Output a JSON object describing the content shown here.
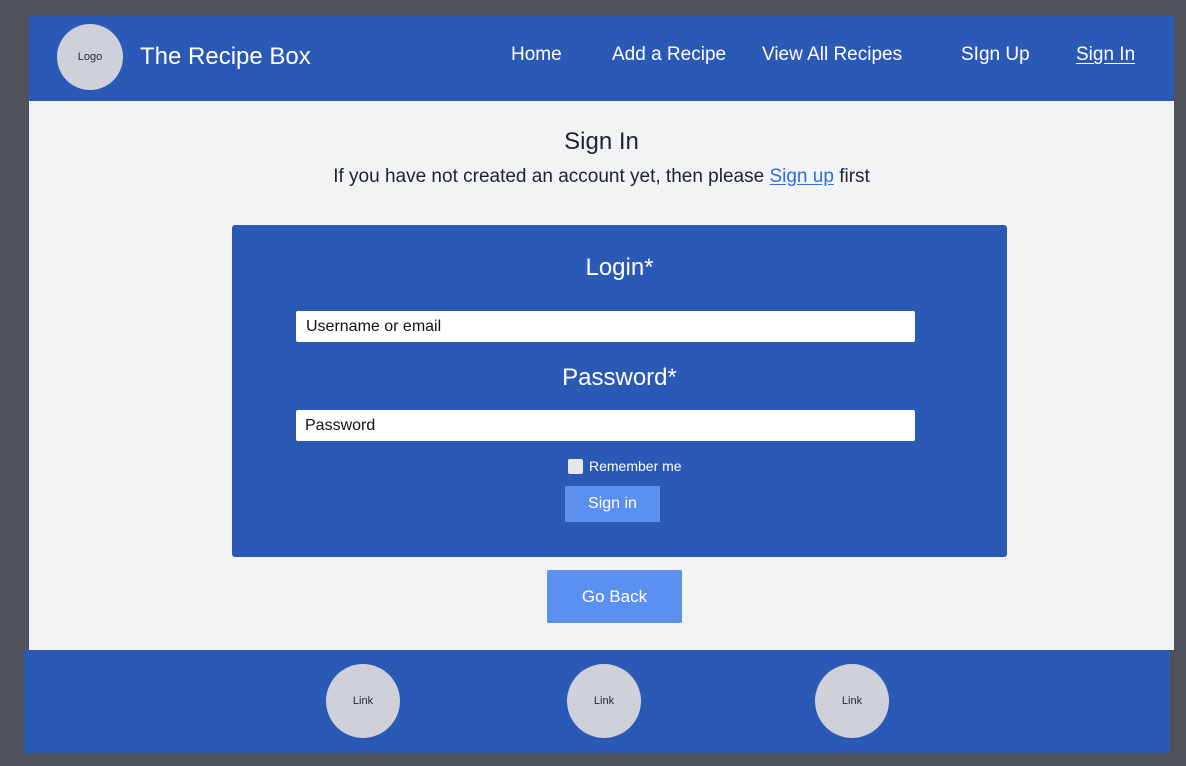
{
  "header": {
    "logo_text": "Logo",
    "brand": "The Recipe Box",
    "nav": [
      {
        "label": "Home"
      },
      {
        "label": "Add a Recipe"
      },
      {
        "label": "View All Recipes"
      },
      {
        "label": "SIgn Up"
      },
      {
        "label": "Sign In",
        "active": true
      }
    ]
  },
  "main": {
    "title": "Sign In",
    "subtitle_before": "If you have not created an account yet, then please",
    "subtitle_link": "Sign up",
    "subtitle_after": "first"
  },
  "form": {
    "login_label": "Login*",
    "login_placeholder": "Username or email",
    "password_label": "Password*",
    "password_placeholder": "Password",
    "remember_label": "Remember me",
    "remember_checked": false,
    "submit_label": "Sign in"
  },
  "go_back_label": "Go Back",
  "footer": {
    "links": [
      {
        "label": "Link"
      },
      {
        "label": "Link"
      },
      {
        "label": "Link"
      }
    ]
  },
  "colors": {
    "outer_background": "#4f525a",
    "page_background": "#f2f3f5",
    "brand_blue": "#2a5ab6",
    "button_blue": "#5b8ff0",
    "link_blue": "#2f6fd6",
    "placeholder_circle": "#ced1d9"
  }
}
